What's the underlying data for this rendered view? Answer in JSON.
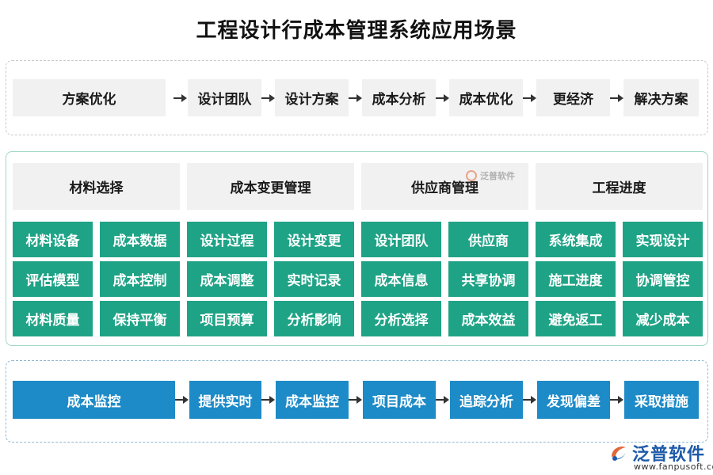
{
  "title": "工程设计行成本管理系统应用场景",
  "row1": [
    "方案优化",
    "设计团队",
    "设计方案",
    "成本分析",
    "成本优化",
    "更经济",
    "解决方案"
  ],
  "headers": [
    "材料选择",
    "成本变更管理",
    "供应商管理",
    "工程进度"
  ],
  "grid": [
    [
      "材料设备",
      "成本数据",
      "设计过程",
      "设计变更",
      "设计团队",
      "供应商",
      "系统集成",
      "实现设计"
    ],
    [
      "评估模型",
      "成本控制",
      "成本调整",
      "实时记录",
      "成本信息",
      "共享协调",
      "施工进度",
      "协调管控"
    ],
    [
      "材料质量",
      "保持平衡",
      "项目预算",
      "分析影响",
      "分析选择",
      "成本效益",
      "避免返工",
      "减少成本"
    ]
  ],
  "row3": [
    "成本监控",
    "提供实时",
    "成本监控",
    "项目成本",
    "追踪分析",
    "发现偏差",
    "采取措施"
  ],
  "watermark": {
    "name": "泛普软件"
  },
  "logo": {
    "name": "泛普软件",
    "url": "www.fanpusoft.com"
  },
  "colors": {
    "green": "#1fa386",
    "blue": "#1d8bc7",
    "gray": "#f1f1f1",
    "logo": "#1e5aa8"
  }
}
